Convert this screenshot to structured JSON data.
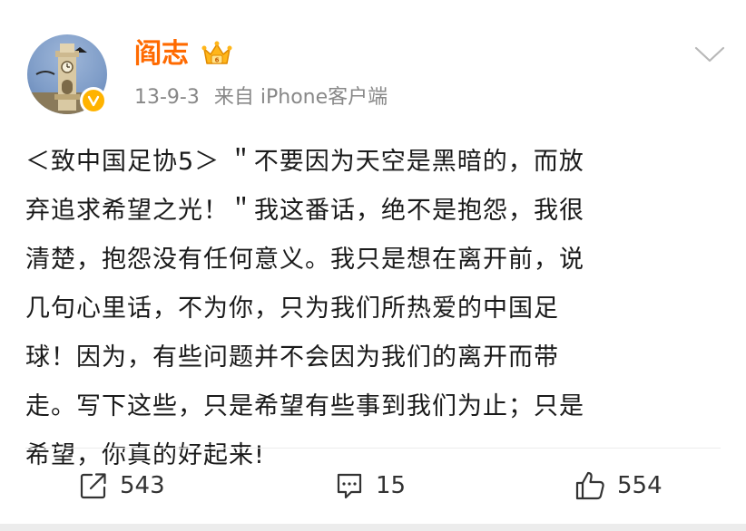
{
  "post": {
    "author": {
      "name": "阎志",
      "avatar_icon": "clock-tower-avatar",
      "verified_icon": "verified-badge-icon",
      "vip_icon": "crown-icon",
      "name_color": "#ff6a00"
    },
    "timestamp": "13-9-3",
    "source": "来自 iPhone客户端",
    "text_lines": [
      "＜致中国足协5＞ ＂不要因为天空是黑暗的，而放",
      "弃追求希望之光！＂我这番话，绝不是抱怨，我很",
      "清楚，抱怨没有任何意义。我只是想在离开前，说",
      "几句心里话，不为你，只为我们所热爱的中国足",
      "球！因为，有些问题并不会因为我们的离开而带",
      "走。写下这些，只是希望有些事到我们为止；只是",
      "希望，你真的好起来!"
    ],
    "menu_icon": "chevron-down-icon"
  },
  "actions": {
    "share": {
      "icon": "share-icon",
      "count": "543"
    },
    "comment": {
      "icon": "comment-icon",
      "count": "15"
    },
    "like": {
      "icon": "thumbs-up-icon",
      "count": "554"
    }
  }
}
